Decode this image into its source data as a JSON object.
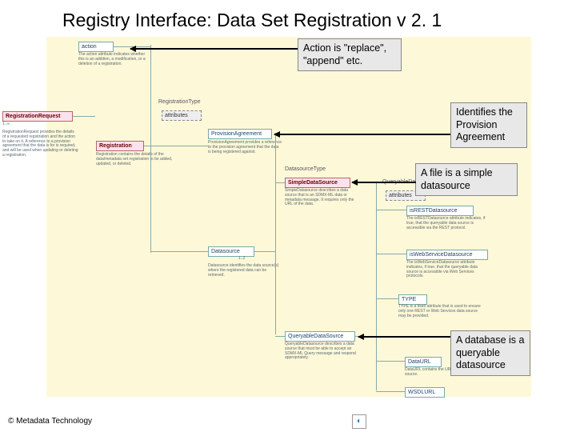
{
  "title": "Registry Interface: Data Set Registration v 2. 1",
  "footer": "©  Metadata Technology",
  "callouts": {
    "action": "Action is \"replace\", \"append\" etc.",
    "provision": "Identifies the Provision Agreement",
    "file": "A file is a simple datasource",
    "database": "A database is  a queryable datasource"
  },
  "nodes": {
    "action": "action",
    "action_desc": "The action attribute indicates whether this is an addition, a modification, or a deletion of a registration.",
    "registration_request": "RegistrationRequest",
    "registration_request_card": "1..∞",
    "registration_request_desc": "RegistrationRequest provides the details of a requested registration and the action to take on it. A reference to a provision agreement that the data is for is required, and will be used when updating or deleting a registration.",
    "registration_type": "RegistrationType",
    "attributes": "attributes",
    "registration": "Registration",
    "registration_desc": "Registration contains the details of the data/metadata set registration to be added, updated, or deleted.",
    "provision_agreement": "ProvisionAgreement",
    "provision_agreement_desc": "ProvisionAgreement provides a reference to the provision agreement that the data is being registered against.",
    "datasource": "Datasource",
    "datasource_card": "1..2",
    "datasource_desc": "Datasource identifies the data source(s) where the registered data can be retrieved.",
    "datasource_type": "DatasourceType",
    "simple_datasource": "SimpleDataSource",
    "simple_datasource_desc": "SimpleDatasource describes a data source that is an SDMX-ML data or metadata message. It requires only the URL of the data.",
    "queryable_datasource": "QueryableDataSource",
    "queryable_datasource_desc": "QueryableDatasource describes a data source that must be able to accept an SDMX-ML Query message and respond appropriately.",
    "queryable_type": "QueryableDataSourceType",
    "attributes2": "attributes",
    "rest": "isRESTDatasource",
    "rest_desc": "The isRESTDatasource attribute indicates, if true, that the queryable data source is accessible via the REST protocol.",
    "ws": "isWebServiceDatasource",
    "ws_desc": "The isWebServiceDatasource attribute indicates, if true, that the queryable data source is accessible via Web Services protocols.",
    "type_attr": "TYPE",
    "type_desc": "TYPE is a fixed attribute that is used to ensure only one REST or Web Services data source may be provided.",
    "dataurl": "DataURL",
    "dataurl_desc": "DataURL contains the URL of the data source.",
    "wsdlurl": "WSDLURL"
  }
}
